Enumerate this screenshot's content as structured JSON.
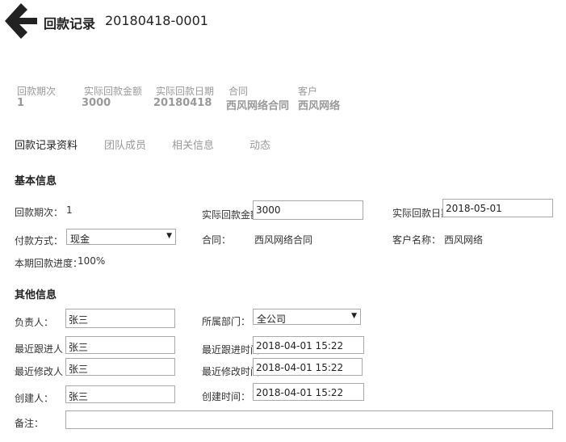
{
  "header": {
    "title": "回款记录",
    "code": "20180418-0001"
  },
  "summary": [
    {
      "label": "回款期次",
      "value": "1"
    },
    {
      "label": "实际回款金额",
      "value": "3000"
    },
    {
      "label": "实际回款日期",
      "value": "20180418"
    },
    {
      "label": "合同",
      "value": "西风网络合同"
    },
    {
      "label": "客户",
      "value": "西风网络"
    }
  ],
  "tabs": [
    "回款记录资料",
    "团队成员",
    "相关信息",
    "动态"
  ],
  "basic": {
    "title": "基本信息",
    "period_label": "回款期次：",
    "period_value": "1",
    "amount_label": "实际回款金额：",
    "amount_value": "3000",
    "date_label": "实际回款日期",
    "date_value": "2018-05-01",
    "pay_label": "付款方式：",
    "pay_value": "现金",
    "contract_label": "合同：",
    "contract_value": "西风网络合同",
    "customer_label": "客户名称：",
    "customer_value": "西风网络",
    "progress_label": "本期回款进度：",
    "progress_value": "100%"
  },
  "other": {
    "title": "其他信息",
    "owner_label": "负责人：",
    "owner_value": "张三",
    "dept_label": "所属部门：",
    "dept_value": "全公司",
    "follower_label": "最近跟进人",
    "follower_value": "张三",
    "follow_time_label": "最近跟进时间",
    "follow_time_value": "2018-04-01 15:22",
    "modifier_label": "最近修改人",
    "modifier_value": "张三",
    "modify_time_label": "最近修改时间",
    "modify_time_value": "2018-04-01 15:22",
    "creator_label": "创建人：",
    "creator_value": "张三",
    "create_time_label": "创建时间：",
    "create_time_value": "2018-04-01 15:22",
    "remark_label": "备注：",
    "remark_value": ""
  }
}
